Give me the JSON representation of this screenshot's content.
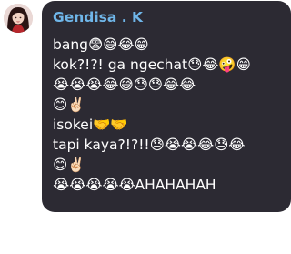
{
  "sender": {
    "name": "Gendisa . K",
    "name_color": "#6fb6e9"
  },
  "message": {
    "lines": [
      "bang😨😅😂😁",
      "kok?!?! ga ngechat😓😂🤪😁",
      "😭😭😭😂😅😓😓😂😂",
      "😊✌🏻",
      "isokei🤝🤝",
      "tapi kaya?!?!!😓😭😭😂😓😂",
      "😊✌🏻",
      "😭😭😭😭😭AHAHAHAH"
    ]
  },
  "colors": {
    "bubble": "#2c2a33",
    "text": "#ffffff",
    "background": "#ffffff"
  }
}
